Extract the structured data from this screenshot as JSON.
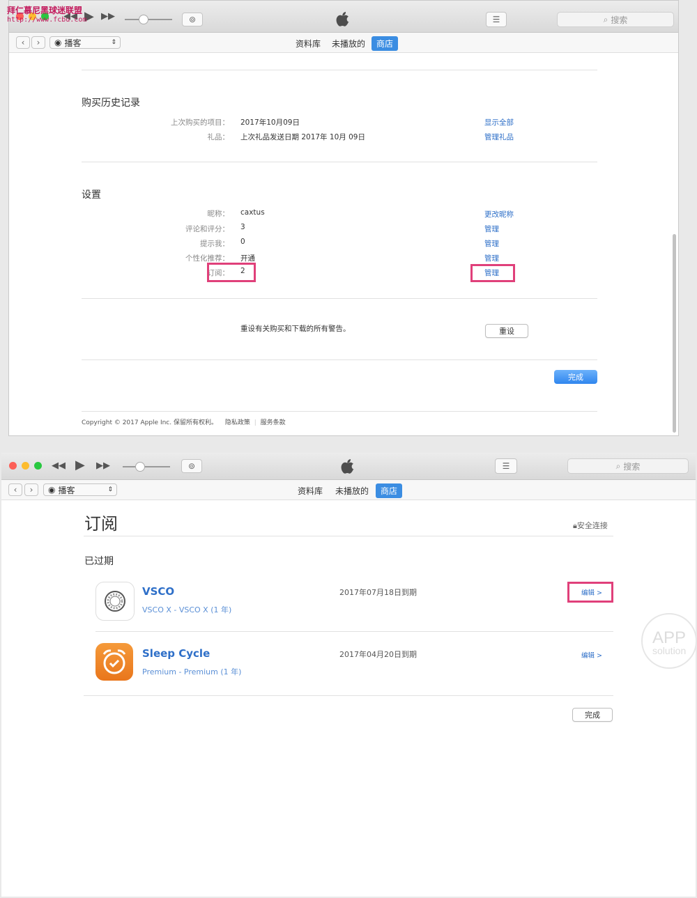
{
  "watermark": {
    "line1": "拜仁慕尼黑球迷联盟",
    "line2": "http://www.fcbu.com"
  },
  "window1": {
    "search_placeholder": "搜索",
    "media_select": "播客",
    "tabs": [
      "资料库",
      "未播放的",
      "商店"
    ],
    "active_tab_index": 2,
    "purchase_history": {
      "title": "购买历史记录",
      "rows": [
        {
          "label": "上次购买的项目：",
          "value": "2017年10月09日",
          "action": "显示全部"
        },
        {
          "label": "礼品：",
          "value": "上次礼品发送日期 2017年 10月 09日",
          "action": "管理礼品"
        }
      ]
    },
    "settings": {
      "title": "设置",
      "rows": [
        {
          "label": "昵称：",
          "value": "caxtus",
          "action": "更改昵称"
        },
        {
          "label": "评论和评分：",
          "value": "3",
          "action": "管理"
        },
        {
          "label": "提示我：",
          "value": "0",
          "action": "管理"
        },
        {
          "label": "个性化推荐：",
          "value": "开通",
          "action": "管理"
        },
        {
          "label": "订阅：",
          "value": "2",
          "action": "管理"
        }
      ]
    },
    "reset_text": "重设有关购买和下载的所有警告。",
    "reset_button": "重设",
    "done_button": "完成",
    "footer": {
      "copyright": "Copyright © 2017 Apple Inc. 保留所有权利。",
      "privacy": "隐私政策",
      "terms": "服务条款"
    }
  },
  "window2": {
    "search_placeholder": "搜索",
    "media_select": "播客",
    "tabs": [
      "资料库",
      "未播放的",
      "商店"
    ],
    "active_tab_index": 2,
    "page_title": "订阅",
    "secure": "安全连接",
    "section": "已过期",
    "subscriptions": [
      {
        "name": "VSCO",
        "plan": "VSCO X - VSCO X (1 年)",
        "expiry": "2017年07月18日到期",
        "edit": "编辑 >"
      },
      {
        "name": "Sleep Cycle",
        "plan": "Premium - Premium (1 年)",
        "expiry": "2017年04月20日到期",
        "edit": "编辑 >"
      }
    ],
    "done_button": "完成"
  },
  "badge": {
    "line1": "APP",
    "line2": "solution"
  },
  "colors": {
    "accent": "#3b8de2",
    "link": "#2e6fc8",
    "highlight": "#e0407a",
    "sleep_cycle": "#f0862d"
  }
}
